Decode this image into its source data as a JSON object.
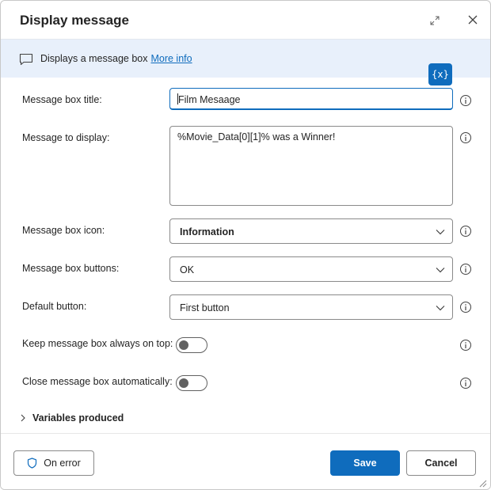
{
  "dialog": {
    "title": "Display message",
    "banner": {
      "text": "Displays a message box",
      "link": "More info"
    },
    "variable_button": "{x}"
  },
  "fields": {
    "title": {
      "label": "Message box title:",
      "value": "Film Mesaage"
    },
    "message": {
      "label": "Message to display:",
      "value": "%Movie_Data[0][1]% was a Winner!"
    },
    "icon": {
      "label": "Message box icon:",
      "value": "Information"
    },
    "buttons": {
      "label": "Message box buttons:",
      "value": "OK"
    },
    "default_button": {
      "label": "Default button:",
      "value": "First button"
    },
    "always_on_top": {
      "label": "Keep message box always on top:",
      "on": false
    },
    "close_auto": {
      "label": "Close message box automatically:",
      "on": false
    }
  },
  "variables_produced": "Variables produced",
  "footer": {
    "on_error": "On error",
    "save": "Save",
    "cancel": "Cancel"
  },
  "colors": {
    "accent": "#0f6cbd",
    "banner_bg": "#e8f0fb"
  },
  "icons": [
    "expand-icon",
    "close-icon",
    "message-icon",
    "info-icon",
    "chevron-down-icon",
    "chevron-right-icon",
    "shield-icon",
    "resize-grip-icon"
  ]
}
